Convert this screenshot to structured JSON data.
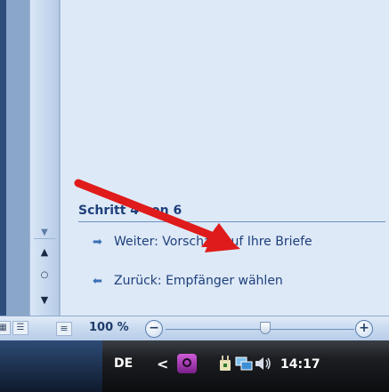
{
  "task_pane": {
    "step_heading": "Schritt 4 von 6",
    "next_link": "Weiter: Vorschau auf Ihre Briefe",
    "back_link": "Zurück: Empfänger wählen"
  },
  "status_bar": {
    "zoom_level": "100 %",
    "zoom_out": "−",
    "zoom_in": "+"
  },
  "taskbar": {
    "language": "DE",
    "tray_expand": "<",
    "clock": "14:17"
  },
  "colors": {
    "annotation_arrow": "#e01b1b",
    "link_text": "#1e3f7c",
    "taskbar": "#0c0d0f"
  }
}
